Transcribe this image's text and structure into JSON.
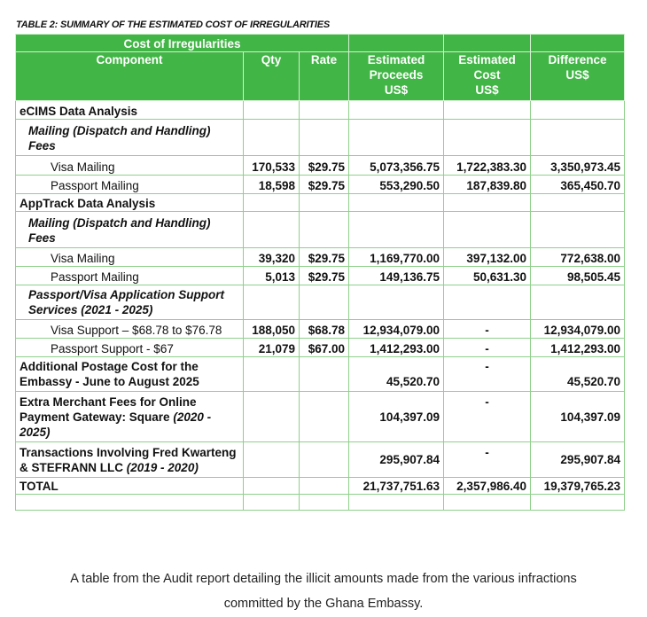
{
  "table_caption": "TABLE 2: SUMMARY OF THE ESTIMATED COST OF IRREGULARITIES",
  "group_header": "Cost of Irregularities",
  "columns": {
    "component": "Component",
    "qty": "Qty",
    "rate": "Rate",
    "proceeds_1": "Estimated",
    "proceeds_2": "Proceeds",
    "proceeds_3": "US$",
    "cost_1": "Estimated",
    "cost_2": "Cost",
    "cost_3": "US$",
    "diff_1": "Difference",
    "diff_2": "US$"
  },
  "rows": {
    "ecims": {
      "label": "eCIMS Data Analysis"
    },
    "ecims_mailing": {
      "label": "Mailing (Dispatch and Handling) Fees"
    },
    "ecims_visa": {
      "label": "Visa Mailing",
      "qty": "170,533",
      "rate": "$29.75",
      "proceeds": "5,073,356.75",
      "cost": "1,722,383.30",
      "diff": "3,350,973.45"
    },
    "ecims_passport": {
      "label": "Passport Mailing",
      "qty": "18,598",
      "rate": "$29.75",
      "proceeds": "553,290.50",
      "cost": "187,839.80",
      "diff": "365,450.70"
    },
    "apptrack": {
      "label": "AppTrack Data Analysis"
    },
    "apptrack_mailing": {
      "label": "Mailing (Dispatch and Handling) Fees"
    },
    "apptrack_visa": {
      "label": "Visa Mailing",
      "qty": "39,320",
      "rate": "$29.75",
      "proceeds": "1,169,770.00",
      "cost": "397,132.00",
      "diff": "772,638.00"
    },
    "apptrack_passport": {
      "label": "Passport Mailing",
      "qty": "5,013",
      "rate": "$29.75",
      "proceeds": "149,136.75",
      "cost": "50,631.30",
      "diff": "98,505.45"
    },
    "support_services": {
      "label": "Passport/Visa Application Support Services (2021 - 2025)"
    },
    "visa_support": {
      "label": "Visa Support – $68.78 to $76.78",
      "qty": "188,050",
      "rate": "$68.78",
      "proceeds": "12,934,079.00",
      "cost": "-",
      "diff": "12,934,079.00"
    },
    "passport_support": {
      "label": "Passport Support - $67",
      "qty": "21,079",
      "rate": "$67.00",
      "proceeds": "1,412,293.00",
      "cost": "-",
      "diff": "1,412,293.00"
    },
    "postage": {
      "label": "Additional Postage Cost for the Embassy - June to August 2025",
      "proceeds": "45,520.70",
      "cost": "-",
      "diff": "45,520.70"
    },
    "merchant": {
      "label_1": "Extra Merchant Fees for Online Payment Gateway: Square",
      "label_2": "(2020 - 2025)",
      "proceeds": "104,397.09",
      "cost": "-",
      "diff": "104,397.09"
    },
    "fred": {
      "label_1": "Transactions Involving Fred Kwarteng & STEFRANN LLC",
      "label_2": "(2019 - 2020)",
      "proceeds": "295,907.84",
      "cost": "-",
      "diff": "295,907.84"
    },
    "total": {
      "label": "TOTAL",
      "proceeds": "21,737,751.63",
      "cost": "2,357,986.40",
      "diff": "19,379,765.23"
    }
  },
  "caption": {
    "line1": "A table from the Audit report detailing the illicit amounts made from the various infractions",
    "line2": "committed by the Ghana Embassy."
  },
  "colors": {
    "header_bg": "#41b545",
    "border": "#8fd08b"
  }
}
